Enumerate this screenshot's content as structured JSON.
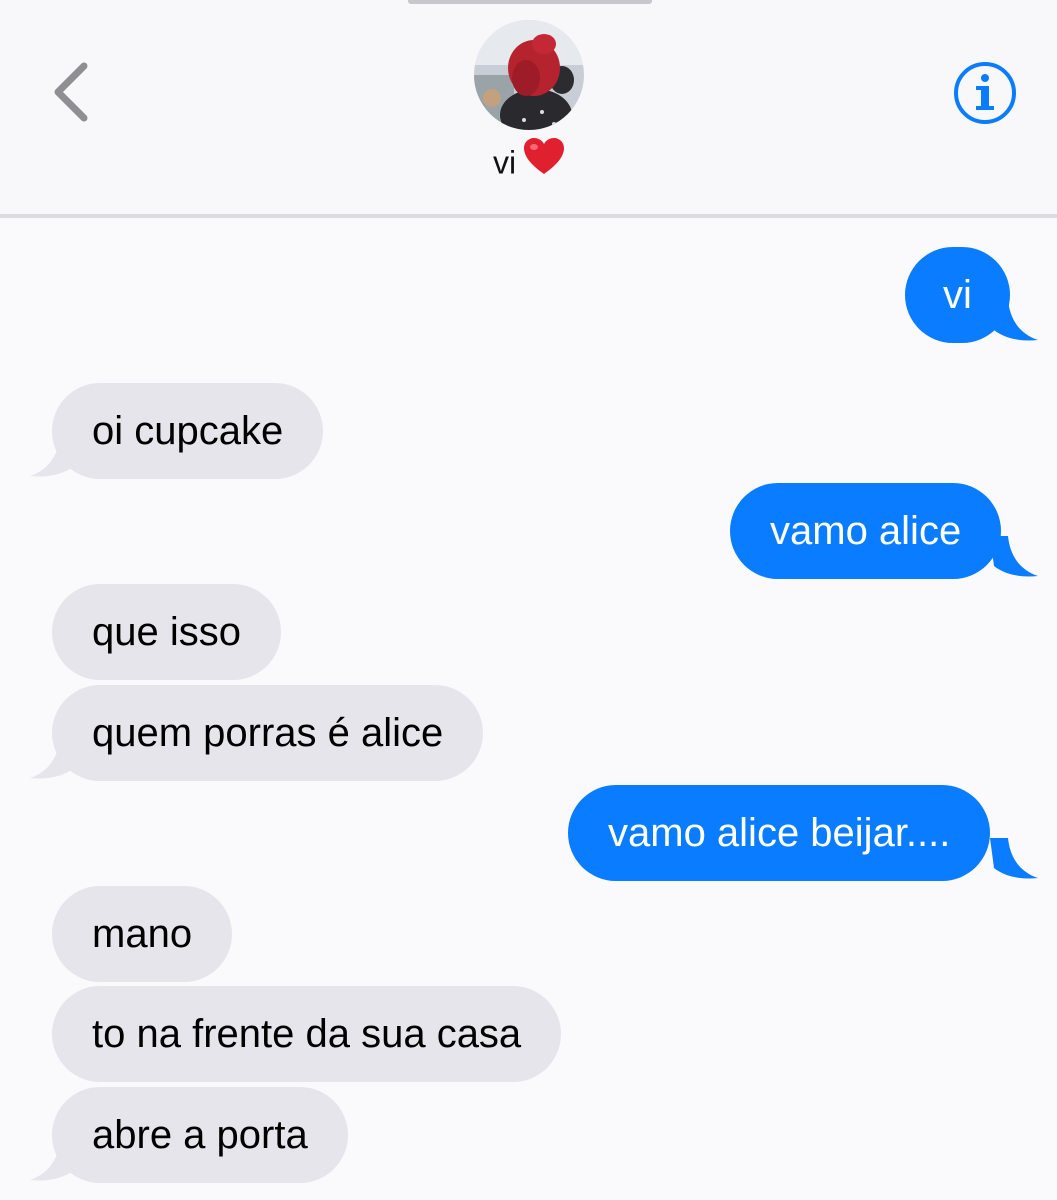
{
  "header": {
    "back_icon": "chevron-left-icon",
    "info_icon": "info-circle-icon",
    "contact_name": "vi",
    "contact_emoji": "red-heart",
    "accent_color": "#0a7cff"
  },
  "messages": [
    {
      "direction": "outgoing",
      "text": "vi"
    },
    {
      "direction": "incoming",
      "text": "oi cupcake"
    },
    {
      "direction": "outgoing",
      "text": "vamo alice"
    },
    {
      "direction": "incoming",
      "text": "que isso"
    },
    {
      "direction": "incoming",
      "text": "quem porras é alice"
    },
    {
      "direction": "outgoing",
      "text": "vamo alice beijar...."
    },
    {
      "direction": "incoming",
      "text": "mano"
    },
    {
      "direction": "incoming",
      "text": "to na frente da sua casa"
    },
    {
      "direction": "incoming",
      "text": "abre a porta"
    }
  ],
  "colors": {
    "incoming_bubble": "#e6e5eb",
    "outgoing_bubble": "#0a7cff",
    "background": "#fafafc"
  }
}
